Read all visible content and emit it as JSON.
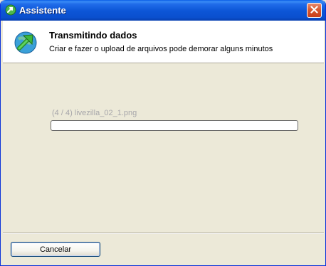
{
  "window": {
    "title": "Assistente",
    "close_icon": "close-x-icon",
    "app_icon": "green-arrow-icon"
  },
  "header": {
    "title": "Transmitindo dados",
    "subtitle": "Criar e fazer o upload de arquivos pode demorar alguns minutos",
    "icon": "upload-arrow-globe-icon"
  },
  "progress": {
    "file_label": "(4 / 4) livezilla_02_1.png",
    "value": 0
  },
  "footer": {
    "cancel_label": "Cancelar"
  },
  "colors": {
    "titlebar": "#0c55d6",
    "close_button": "#d9592f",
    "dialog_background": "#ece9d8",
    "header_background": "#ffffff",
    "file_label_text": "#a7a6aa"
  }
}
